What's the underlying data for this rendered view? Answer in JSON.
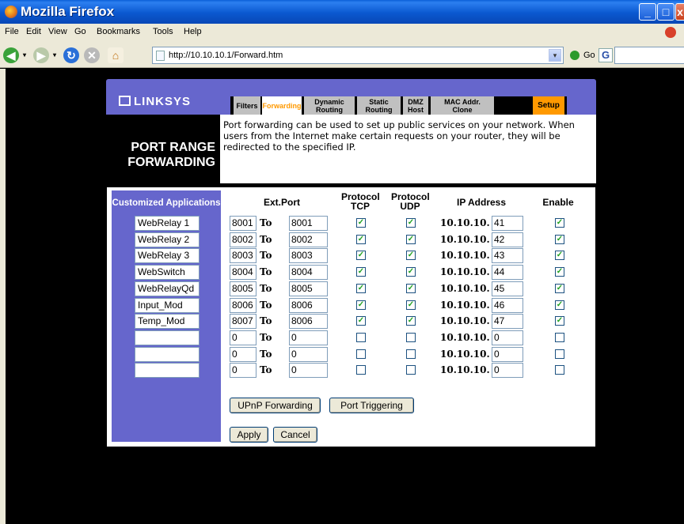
{
  "browser": {
    "title": "Mozilla Firefox",
    "menu": [
      "File",
      "Edit",
      "View",
      "Go",
      "Bookmarks",
      "Tools",
      "Help"
    ],
    "url": "http://10.10.10.1/Forward.htm",
    "go_label": "Go",
    "search_engine_icon": "G"
  },
  "router": {
    "logo": "LINKSYS",
    "tabs": {
      "filters": "Filters",
      "forwarding": "Forwarding",
      "dynamic": "Dynamic Routing",
      "static": "Static Routing",
      "dmz": "DMZ Host",
      "mac": "MAC Addr. Clone",
      "setup": "Setup"
    },
    "page_title_line1": "PORT RANGE",
    "page_title_line2": "FORWARDING",
    "description": "Port forwarding can be used to set up public services on your network. When users from the Internet make certain requests on your router, they will be redirected to the specified IP.",
    "table": {
      "side_header": "Customized Applications",
      "col_extport": "Ext.Port",
      "col_tcp": "Protocol TCP",
      "col_udp": "Protocol UDP",
      "col_ip": "IP Address",
      "col_enable": "Enable",
      "to_label": "To",
      "ip_prefix": "10.10.10.",
      "rows": [
        {
          "app": "WebRelay 1",
          "start": "8001",
          "end": "8001",
          "tcp": true,
          "udp": true,
          "ip": "41",
          "enable": true
        },
        {
          "app": "WebRelay 2",
          "start": "8002",
          "end": "8002",
          "tcp": true,
          "udp": true,
          "ip": "42",
          "enable": true
        },
        {
          "app": "WebRelay 3",
          "start": "8003",
          "end": "8003",
          "tcp": true,
          "udp": true,
          "ip": "43",
          "enable": true
        },
        {
          "app": "WebSwitch",
          "start": "8004",
          "end": "8004",
          "tcp": true,
          "udp": true,
          "ip": "44",
          "enable": true
        },
        {
          "app": "WebRelayQd",
          "start": "8005",
          "end": "8005",
          "tcp": true,
          "udp": true,
          "ip": "45",
          "enable": true
        },
        {
          "app": "Input_Mod",
          "start": "8006",
          "end": "8006",
          "tcp": true,
          "udp": true,
          "ip": "46",
          "enable": true
        },
        {
          "app": "Temp_Mod",
          "start": "8007",
          "end": "8006",
          "tcp": true,
          "udp": true,
          "ip": "47",
          "enable": true
        },
        {
          "app": "",
          "start": "0",
          "end": "0",
          "tcp": false,
          "udp": false,
          "ip": "0",
          "enable": false
        },
        {
          "app": "",
          "start": "0",
          "end": "0",
          "tcp": false,
          "udp": false,
          "ip": "0",
          "enable": false
        },
        {
          "app": "",
          "start": "0",
          "end": "0",
          "tcp": false,
          "udp": false,
          "ip": "0",
          "enable": false
        }
      ]
    },
    "buttons": {
      "upnp": "UPnP Forwarding",
      "trigger": "Port Triggering",
      "apply": "Apply",
      "cancel": "Cancel"
    }
  }
}
